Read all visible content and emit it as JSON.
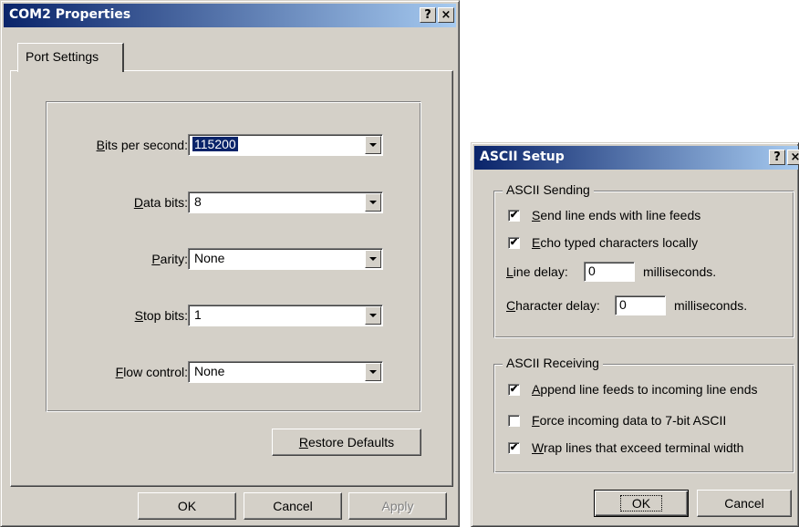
{
  "com2": {
    "title": "COM2 Properties",
    "help_glyph": "?",
    "close_glyph": "×",
    "tab_label": "Port Settings",
    "fields": [
      {
        "label": "Bits per second:",
        "key": "B",
        "rest": "its per second:",
        "value": "115200"
      },
      {
        "label": "Data bits:",
        "key": "D",
        "rest": "ata bits:",
        "value": "8"
      },
      {
        "label": "Parity:",
        "key": "P",
        "rest": "arity:",
        "value": "None"
      },
      {
        "label": "Stop bits:",
        "key": "S",
        "rest": "top bits:",
        "value": "1"
      },
      {
        "label": "Flow control:",
        "key": "F",
        "rest": "low control:",
        "value": "None"
      }
    ],
    "restore": {
      "key": "R",
      "rest": "estore Defaults"
    },
    "buttons": {
      "ok": "OK",
      "cancel": "Cancel",
      "apply": "Apply"
    }
  },
  "ascii": {
    "title": "ASCII Setup",
    "help_glyph": "?",
    "close_glyph": "×",
    "sending": {
      "legend": "ASCII Sending",
      "send_line_ends": {
        "key": "S",
        "rest": "end line ends with line feeds",
        "checked": true
      },
      "echo_typed": {
        "key": "E",
        "rest": "cho typed characters locally",
        "checked": true
      },
      "line_delay": {
        "key": "L",
        "rest": "ine delay:",
        "value": "0",
        "unit": "milliseconds."
      },
      "char_delay": {
        "key": "C",
        "rest": "haracter delay:",
        "value": "0",
        "unit": "milliseconds."
      }
    },
    "receiving": {
      "legend": "ASCII Receiving",
      "append_line_feeds": {
        "key": "A",
        "rest": "ppend line feeds to incoming line ends",
        "checked": true
      },
      "force_7bit": {
        "key": "F",
        "rest": "orce incoming data to 7-bit ASCII",
        "checked": false
      },
      "wrap_lines": {
        "key": "W",
        "rest": "rap lines that exceed terminal width",
        "checked": true
      }
    },
    "buttons": {
      "ok": "OK",
      "cancel": "Cancel"
    }
  },
  "colors": {
    "title_start": "#0a246a",
    "title_end": "#a6caf0",
    "face": "#d4d0c8"
  }
}
